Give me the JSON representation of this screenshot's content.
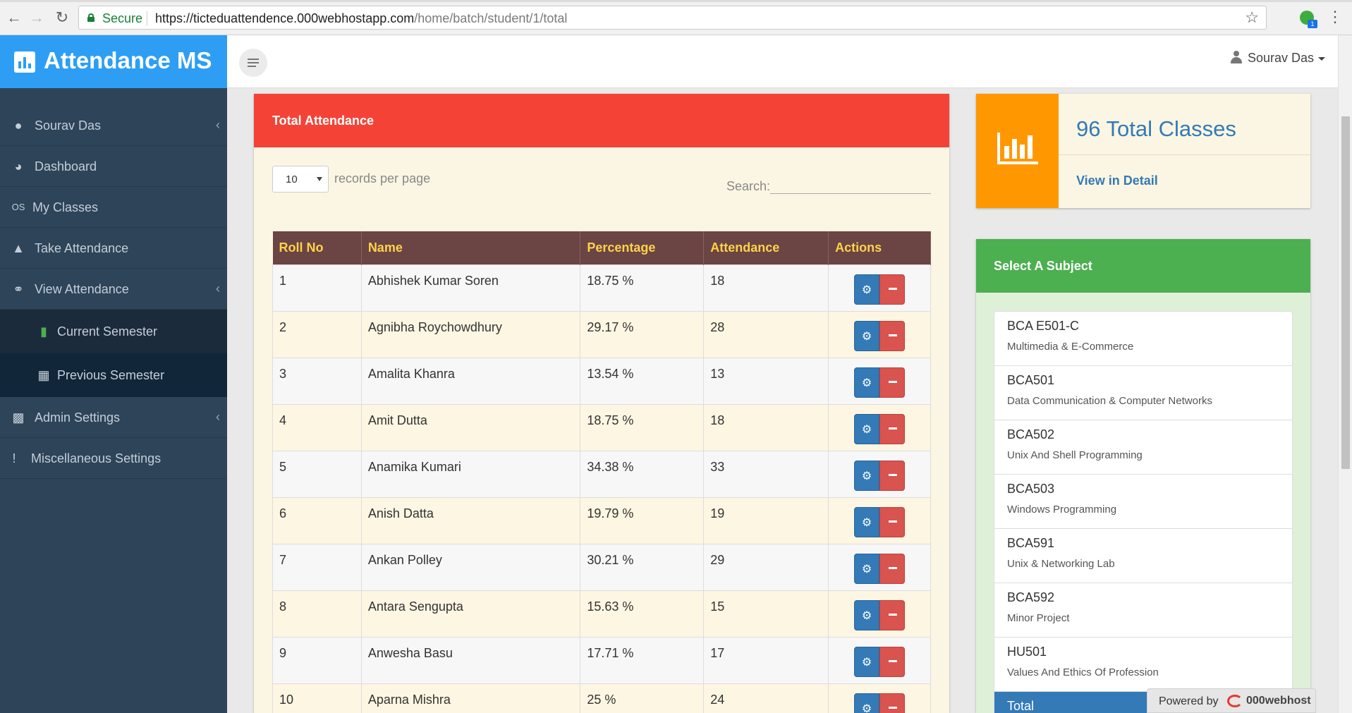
{
  "browser": {
    "secure_label": "Secure",
    "url_host": "https://ticteduattendence.000webhostapp.com",
    "url_path": "/home/batch/student/1/total",
    "ext_badge": "1"
  },
  "app": {
    "title": "Attendance MS"
  },
  "sidebar": {
    "items": [
      {
        "label": "Sourav Das",
        "icon": "user-icon",
        "chevron": true
      },
      {
        "label": "Dashboard",
        "icon": "dashboard-icon",
        "chevron": false
      },
      {
        "label": "My Classes",
        "icon": "classes-icon",
        "chevron": false
      },
      {
        "label": "Take Attendance",
        "icon": "graduation-cap-icon",
        "chevron": false
      },
      {
        "label": "View Attendance",
        "icon": "binoculars-icon",
        "chevron": true
      },
      {
        "label": "Current Semester",
        "icon": "bar-chart-icon",
        "sub": true,
        "active": true
      },
      {
        "label": "Previous Semester",
        "icon": "table-icon",
        "sub": true
      },
      {
        "label": "Admin Settings",
        "icon": "sitemap-icon",
        "chevron": true
      },
      {
        "label": "Miscellaneous Settings",
        "icon": "exclamation-icon",
        "chevron": false
      }
    ]
  },
  "header": {
    "user": "Sourav Das"
  },
  "attendance": {
    "title": "Total Attendance",
    "per_page_value": "10",
    "per_page_label": "records per page",
    "search_label": "Search:",
    "columns": [
      "Roll No",
      "Name",
      "Percentage",
      "Attendance",
      "Actions"
    ],
    "rows": [
      {
        "roll": "1",
        "name": "Abhishek Kumar Soren",
        "pct": "18.75 %",
        "att": "18"
      },
      {
        "roll": "2",
        "name": "Agnibha Roychowdhury",
        "pct": "29.17 %",
        "att": "28"
      },
      {
        "roll": "3",
        "name": "Amalita Khanra",
        "pct": "13.54 %",
        "att": "13"
      },
      {
        "roll": "4",
        "name": "Amit Dutta",
        "pct": "18.75 %",
        "att": "18"
      },
      {
        "roll": "5",
        "name": "Anamika Kumari",
        "pct": "34.38 %",
        "att": "33"
      },
      {
        "roll": "6",
        "name": "Anish Datta",
        "pct": "19.79 %",
        "att": "19"
      },
      {
        "roll": "7",
        "name": "Ankan Polley",
        "pct": "30.21 %",
        "att": "29"
      },
      {
        "roll": "8",
        "name": "Antara Sengupta",
        "pct": "15.63 %",
        "att": "15"
      },
      {
        "roll": "9",
        "name": "Anwesha Basu",
        "pct": "17.71 %",
        "att": "17"
      },
      {
        "roll": "10",
        "name": "Aparna Mishra",
        "pct": "25 %",
        "att": "24"
      }
    ]
  },
  "stats": {
    "total_classes": "96 Total Classes",
    "link": "View in Detail"
  },
  "subjects": {
    "title": "Select A Subject",
    "items": [
      {
        "code": "BCA E501-C",
        "name": "Multimedia & E-Commerce"
      },
      {
        "code": "BCA501",
        "name": "Data Communication & Computer Networks"
      },
      {
        "code": "BCA502",
        "name": "Unix And Shell Programming"
      },
      {
        "code": "BCA503",
        "name": "Windows Programming"
      },
      {
        "code": "BCA591",
        "name": "Unix & Networking Lab"
      },
      {
        "code": "BCA592",
        "name": "Minor Project"
      },
      {
        "code": "HU501",
        "name": "Values And Ethics Of Profession"
      }
    ],
    "active_label": "Total"
  },
  "footer": {
    "powered_by": "Powered by",
    "brand": "000webhost"
  },
  "colors": {
    "brand": "#2d9ef4",
    "sidebar": "#2d4459",
    "danger": "#f44336",
    "warning": "#ff9800",
    "success": "#4caf50",
    "primary": "#337ab7"
  }
}
